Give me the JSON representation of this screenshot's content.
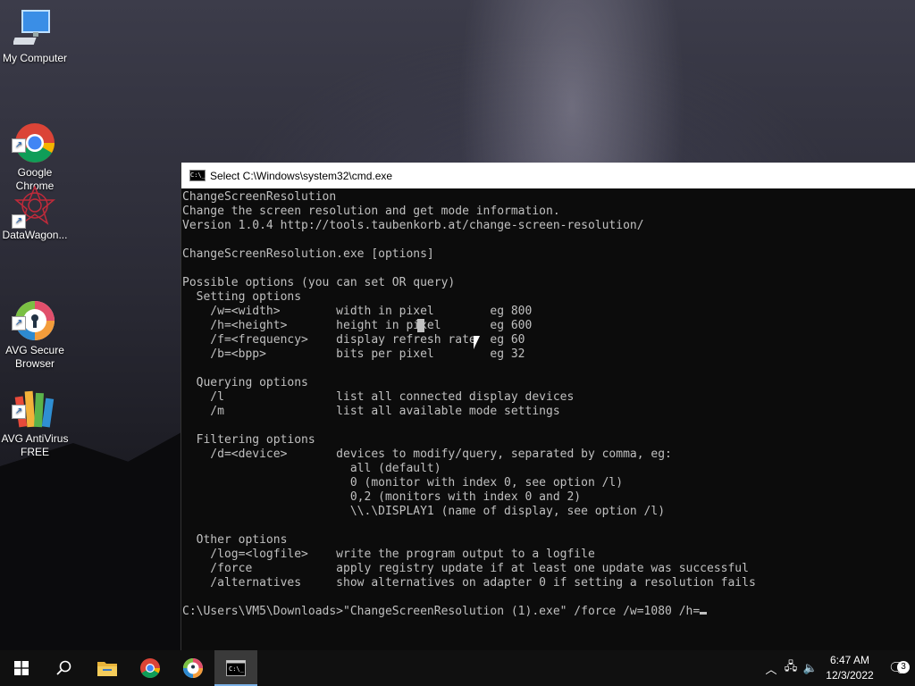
{
  "desktop": {
    "icons": [
      {
        "label": "My Computer",
        "icon": "computer-icon"
      },
      {
        "label": "Google\nChrome",
        "icon": "chrome-icon"
      },
      {
        "label": "DataWagon...",
        "icon": "datawagon-icon"
      },
      {
        "label": "AVG Secure\nBrowser",
        "icon": "avg-secure-browser-icon"
      },
      {
        "label": "AVG AntiVirus\nFREE",
        "icon": "avg-antivirus-icon"
      }
    ]
  },
  "window": {
    "title": "Select C:\\Windows\\system32\\cmd.exe",
    "icon_text": "C:\\_"
  },
  "console": {
    "lines": [
      "ChangeScreenResolution",
      "Change the screen resolution and get mode information.",
      "Version 1.0.4 http://tools.taubenkorb.at/change-screen-resolution/",
      "",
      "ChangeScreenResolution.exe [options]",
      "",
      "Possible options (you can set OR query)",
      "  Setting options",
      "    /w=<width>        width in pixel        eg 800",
      "    /h=<height>       height in pixel       eg 600",
      "    /f=<frequency>    display refresh rate  eg 60",
      "    /b=<bpp>          bits per pixel        eg 32",
      "",
      "  Querying options",
      "    /l                list all connected display devices",
      "    /m                list all available mode settings",
      "",
      "  Filtering options",
      "    /d=<device>       devices to modify/query, separated by comma, eg:",
      "                        all (default)",
      "                        0 (monitor with index 0, see option /l)",
      "                        0,2 (monitors with index 0 and 2)",
      "                        \\\\.\\DISPLAY1 (name of display, see option /l)",
      "",
      "  Other options",
      "    /log=<logfile>    write the program output to a logfile",
      "    /force            apply registry update if at least one update was successful",
      "    /alternatives     show alternatives on adapter 0 if setting a resolution fails",
      ""
    ],
    "prompt": "C:\\Users\\VM5\\Downloads>\"ChangeScreenResolution (1).exe\" /force /w=1080 /h="
  },
  "taskbar": {
    "items": [
      {
        "name": "start-button",
        "icon": "windows-logo-icon"
      },
      {
        "name": "search-button",
        "icon": "search-icon"
      },
      {
        "name": "file-explorer-button",
        "icon": "folder-icon"
      },
      {
        "name": "chrome-taskbar-button",
        "icon": "chrome-icon"
      },
      {
        "name": "avg-browser-taskbar-button",
        "icon": "avg-secure-browser-icon"
      },
      {
        "name": "cmd-taskbar-button",
        "icon": "cmd-icon"
      }
    ],
    "tray": {
      "time": "6:47 AM",
      "date": "12/3/2022",
      "notification_count": "3"
    }
  }
}
